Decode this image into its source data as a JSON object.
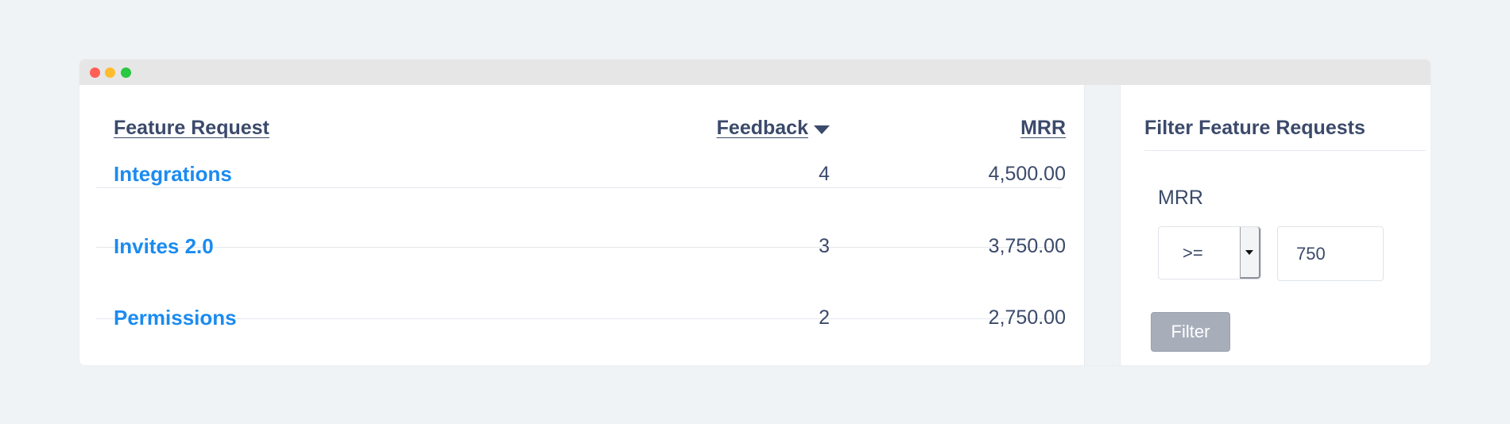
{
  "table": {
    "headers": {
      "feature": "Feature Request",
      "feedback": "Feedback",
      "mrr": "MRR"
    },
    "sort_icon": "caret-down-icon",
    "rows": [
      {
        "name": "Integrations",
        "feedback": "4",
        "mrr": "4,500.00"
      },
      {
        "name": "Invites 2.0",
        "feedback": "3",
        "mrr": "3,750.00"
      },
      {
        "name": "Permissions",
        "feedback": "2",
        "mrr": "2,750.00"
      }
    ]
  },
  "filter": {
    "title": "Filter Feature Requests",
    "field_label": "MRR",
    "operator": ">=",
    "value": "750",
    "button_label": "Filter"
  },
  "colors": {
    "link": "#1b8bf0",
    "text": "#3b4a6b",
    "disabled_button": "#a7aeba"
  }
}
